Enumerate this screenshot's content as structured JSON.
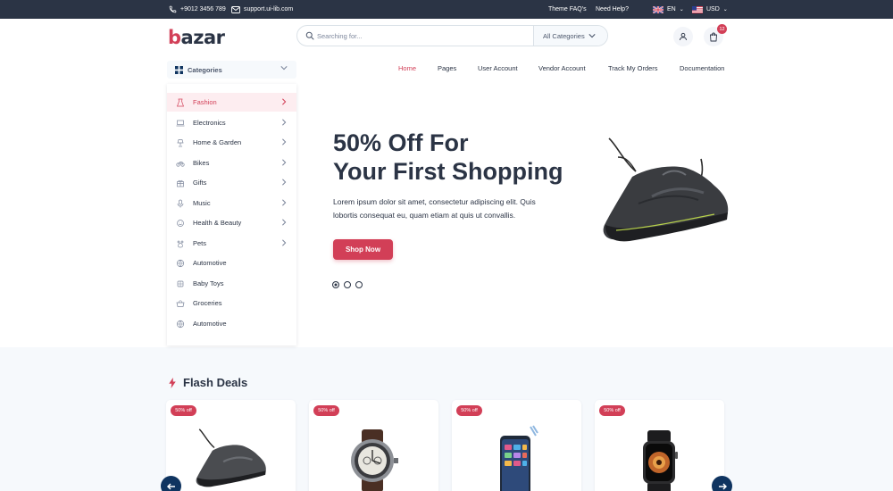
{
  "topbar": {
    "phone": "+9012 3456 789",
    "email": "support.ui-lib.com",
    "faq": "Theme FAQ's",
    "help": "Need Help?",
    "language": "EN",
    "currency": "USD"
  },
  "header": {
    "logo_accent": "b",
    "logo_rest": "azar",
    "search_placeholder": "Searching for...",
    "search_category": "All Categories",
    "cart_count": "12"
  },
  "nav": {
    "categories_label": "Categories",
    "links": [
      "Home",
      "Pages",
      "User Account",
      "Vendor Account",
      "Track My Orders",
      "Documentation"
    ]
  },
  "categories": [
    {
      "label": "Fashion",
      "icon": "dress-icon",
      "has_sub": true
    },
    {
      "label": "Electronics",
      "icon": "laptop-icon",
      "has_sub": true
    },
    {
      "label": "Home & Garden",
      "icon": "lamp-icon",
      "has_sub": true
    },
    {
      "label": "Bikes",
      "icon": "bike-icon",
      "has_sub": true
    },
    {
      "label": "Gifts",
      "icon": "gift-icon",
      "has_sub": true
    },
    {
      "label": "Music",
      "icon": "microphone-icon",
      "has_sub": true
    },
    {
      "label": "Health & Beauty",
      "icon": "beauty-icon",
      "has_sub": true
    },
    {
      "label": "Pets",
      "icon": "paw-icon",
      "has_sub": true
    },
    {
      "label": "Automotive",
      "icon": "globe-icon",
      "has_sub": false
    },
    {
      "label": "Baby Toys",
      "icon": "toy-icon",
      "has_sub": false
    },
    {
      "label": "Groceries",
      "icon": "basket-icon",
      "has_sub": false
    },
    {
      "label": "Automotive",
      "icon": "globe-icon",
      "has_sub": false
    }
  ],
  "hero": {
    "title_line1": "50% Off For",
    "title_line2": "Your First Shopping",
    "text": "Lorem ipsum dolor sit amet, consectetur adipiscing elit. Quis lobortis consequat eu, quam etiam at quis ut convallis.",
    "button": "Shop Now",
    "slides": 3,
    "active_slide": 1
  },
  "flash_deals": {
    "title": "Flash Deals",
    "cards": [
      {
        "badge": "50% off",
        "product": "sneaker"
      },
      {
        "badge": "50% off",
        "product": "wristwatch"
      },
      {
        "badge": "50% off",
        "product": "smartphone"
      },
      {
        "badge": "50% off",
        "product": "smartwatch"
      }
    ]
  },
  "colors": {
    "primary": "#d23f57",
    "dark": "#2b3445",
    "navy": "#0f3460",
    "background": "#f6f9fc"
  }
}
